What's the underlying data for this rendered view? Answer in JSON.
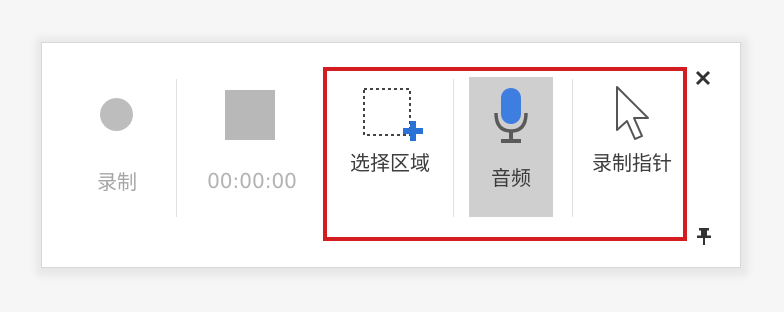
{
  "toolbar": {
    "record": {
      "label": "录制",
      "enabled": false
    },
    "stop": {
      "time": "00:00:00",
      "enabled": false
    },
    "select_area": {
      "label": "选择区域",
      "enabled": true
    },
    "audio": {
      "label": "音频",
      "enabled": true,
      "selected": true
    },
    "record_pointer": {
      "label": "录制指针",
      "enabled": true
    },
    "close_icon": "close-icon",
    "pin_icon": "pin-icon"
  },
  "colors": {
    "highlight_frame": "#d41d21",
    "mic_blue": "#3d7ee0",
    "plus_blue": "#2b72d6",
    "selected_bg": "#cfcfcf",
    "disabled_gray": "#b8b8b8"
  }
}
